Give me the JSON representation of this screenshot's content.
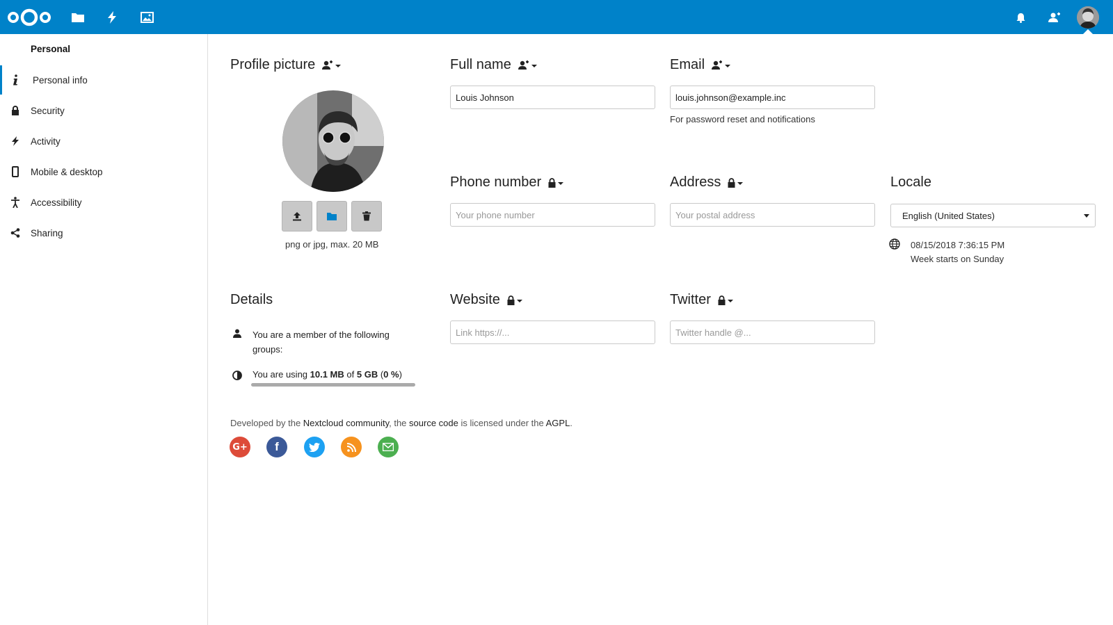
{
  "header": {
    "icons": [
      "nextcloud-logo",
      "files-icon",
      "activity-icon",
      "gallery-icon",
      "notifications-icon",
      "contacts-icon",
      "user-avatar"
    ],
    "brand_color": "#0082c9"
  },
  "sidebar": {
    "heading": "Personal",
    "items": [
      {
        "label": "Personal info",
        "icon": "info-icon"
      },
      {
        "label": "Security",
        "icon": "lock-icon"
      },
      {
        "label": "Activity",
        "icon": "lightning-icon"
      },
      {
        "label": "Mobile & desktop",
        "icon": "phone-icon"
      },
      {
        "label": "Accessibility",
        "icon": "accessibility-icon"
      },
      {
        "label": "Sharing",
        "icon": "share-icon"
      }
    ]
  },
  "profile_picture": {
    "title": "Profile picture",
    "hint": "png or jpg, max. 20 MB"
  },
  "full_name": {
    "title": "Full name",
    "value": "Louis Johnson"
  },
  "email": {
    "title": "Email",
    "value": "louis.johnson@example.inc",
    "hint": "For password reset and notifications"
  },
  "phone": {
    "title": "Phone number",
    "placeholder": "Your phone number"
  },
  "address": {
    "title": "Address",
    "placeholder": "Your postal address"
  },
  "locale": {
    "title": "Locale",
    "selected": "English (United States)",
    "datetime": "08/15/2018 7:36:15 PM",
    "week_start": "Week starts on Sunday"
  },
  "website": {
    "title": "Website",
    "placeholder": "Link https://..."
  },
  "twitter": {
    "title": "Twitter",
    "placeholder": "Twitter handle @..."
  },
  "details": {
    "title": "Details",
    "groups_text": "You are a member of the following groups:",
    "usage_prefix": "You are using ",
    "usage_used": "10.1 MB",
    "usage_of": " of ",
    "usage_total": "5 GB",
    "usage_open": " (",
    "usage_percent": "0 %",
    "usage_close": ")",
    "usage_fraction": 0.002
  },
  "footer": {
    "t1": "Developed by the ",
    "l1": "Nextcloud community",
    "t2": ", the ",
    "l2": "source code",
    "t3": " is licensed under the ",
    "l3": "AGPL",
    "t4": ".",
    "social_colors": [
      "#dd4b39",
      "#3b5998",
      "#1da1f2",
      "#f6921e",
      "#4caf50"
    ]
  }
}
